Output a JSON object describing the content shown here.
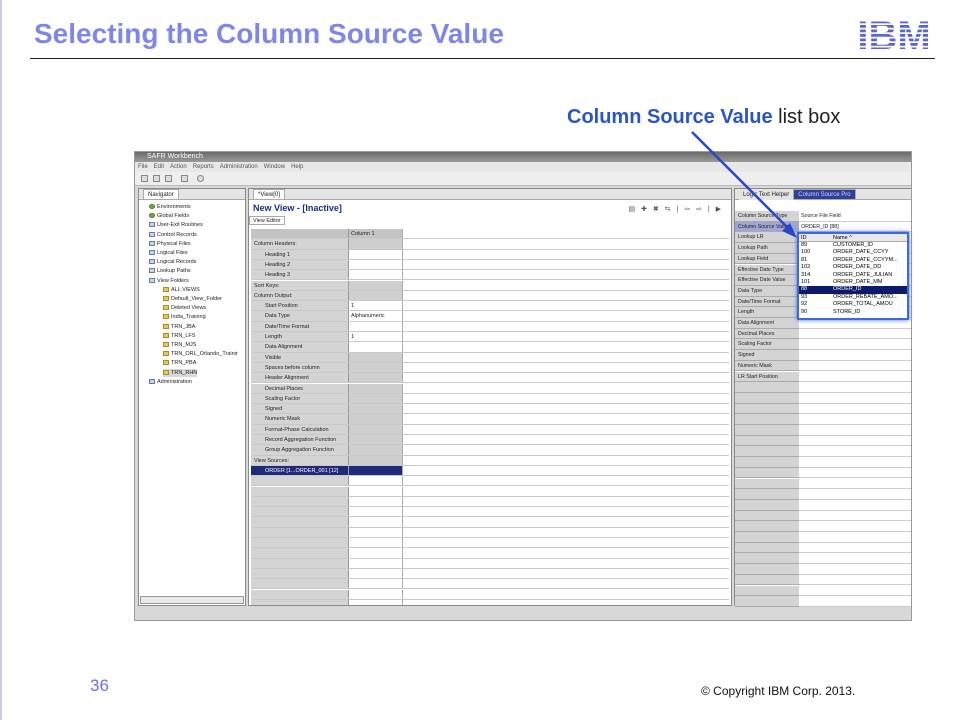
{
  "slide": {
    "title": "Selecting the Column Source Value",
    "callout_bold": "Column Source Value",
    "callout_rest": " list box",
    "page_number": "36",
    "copyright": "© Copyright  IBM Corp. 2013.",
    "logo_text": "IBM"
  },
  "app": {
    "window_title": "SAFR Workbench",
    "menu": [
      "File",
      "Edit",
      "Action",
      "Reports",
      "Administration",
      "Window",
      "Help"
    ]
  },
  "navigator": {
    "tab": "Navigator",
    "items": [
      {
        "label": "Environments",
        "indent": 0
      },
      {
        "label": "Global Fields",
        "indent": 0
      },
      {
        "label": "User-Exit Routines",
        "indent": 0
      },
      {
        "label": "Control Records",
        "indent": 0
      },
      {
        "label": "Physical Files",
        "indent": 0
      },
      {
        "label": "Logical Files",
        "indent": 0
      },
      {
        "label": "Logical Records",
        "indent": 0
      },
      {
        "label": "Lookup Paths",
        "indent": 0
      },
      {
        "label": "View Folders",
        "indent": 0
      },
      {
        "label": "ALL VIEWS",
        "indent": 1
      },
      {
        "label": "Default_View_Folder",
        "indent": 1
      },
      {
        "label": "Deleted Views",
        "indent": 1
      },
      {
        "label": "India_Training",
        "indent": 1
      },
      {
        "label": "TRN_JBA",
        "indent": 1
      },
      {
        "label": "TRN_LFS",
        "indent": 1
      },
      {
        "label": "TRN_MJS",
        "indent": 1
      },
      {
        "label": "TRN_ORL_Orlando_Trainir",
        "indent": 1
      },
      {
        "label": "TRN_PBA",
        "indent": 1
      },
      {
        "label": "TRN_RHN",
        "indent": 1
      },
      {
        "label": "Administration",
        "indent": 0
      }
    ]
  },
  "view_editor": {
    "tab": "*View[0]",
    "title": "New View - [Inactive]",
    "subtab": "View Editor",
    "column_header": "Column 1",
    "rows": [
      {
        "label": "Column Headers:",
        "value": "",
        "hd": true
      },
      {
        "label": "Heading 1",
        "value": ""
      },
      {
        "label": "Heading 2",
        "value": ""
      },
      {
        "label": "Heading 3",
        "value": ""
      },
      {
        "label": "Sort Keys:",
        "value": "",
        "hd": true
      },
      {
        "label": "Column Output:",
        "value": "",
        "hd": true
      },
      {
        "label": "Start Position",
        "value": "1"
      },
      {
        "label": "Data Type",
        "value": "Alphanumeric"
      },
      {
        "label": "Date/Time Format",
        "value": ""
      },
      {
        "label": "Length",
        "value": "1"
      },
      {
        "label": "Data Alignment",
        "value": ""
      },
      {
        "label": "Visible",
        "value": ""
      },
      {
        "label": "Spaces before column",
        "value": ""
      },
      {
        "label": "Header Alignment",
        "value": ""
      },
      {
        "label": "Decimal Places",
        "value": ""
      },
      {
        "label": "Scaling Factor",
        "value": ""
      },
      {
        "label": "Signed",
        "value": ""
      },
      {
        "label": "Numeric Mask",
        "value": ""
      },
      {
        "label": "Format-Phase Calculation",
        "value": ""
      },
      {
        "label": "Record Aggregation Function",
        "value": ""
      },
      {
        "label": "Group Aggregation Function",
        "value": ""
      },
      {
        "label": "View Sources:",
        "value": "",
        "hd": true
      },
      {
        "label": "ORDER [1...ORDER_001 [12]",
        "value": ""
      }
    ]
  },
  "source_panel": {
    "tab1": "Logic Text Helper",
    "tab2": "Column Source Pro",
    "rows": [
      {
        "label": "Column Source Type",
        "value": "Source File Field"
      },
      {
        "label": "Column Source Value",
        "value": "ORDER_ID [88]"
      },
      {
        "label": "Lookup LR",
        "value": ""
      },
      {
        "label": "Lookup Path",
        "value": ""
      },
      {
        "label": "Lookup Field",
        "value": ""
      },
      {
        "label": "Effective Date Type",
        "value": ""
      },
      {
        "label": "Effective Date Value",
        "value": ""
      },
      {
        "label": "Data Type",
        "value": ""
      },
      {
        "label": "Date/Time Format",
        "value": ""
      },
      {
        "label": "Length",
        "value": ""
      },
      {
        "label": "Data Alignment",
        "value": ""
      },
      {
        "label": "Decimal Places",
        "value": ""
      },
      {
        "label": "Scaling Factor",
        "value": ""
      },
      {
        "label": "Signed",
        "value": ""
      },
      {
        "label": "Numeric Mask",
        "value": ""
      },
      {
        "label": "LR Start Position",
        "value": ""
      }
    ]
  },
  "listbox": {
    "col_id": "ID",
    "col_name": "Name  ^",
    "items": [
      {
        "id": "89",
        "name": "CUSTOMER_ID"
      },
      {
        "id": "100",
        "name": "ORDER_DATE_CCYY"
      },
      {
        "id": "81",
        "name": "ORDER_DATE_CCYYM..."
      },
      {
        "id": "102",
        "name": "ORDER_DATE_DD"
      },
      {
        "id": "314",
        "name": "ORDER_DATE_JULIAN"
      },
      {
        "id": "101",
        "name": "ORDER_DATE_MM"
      },
      {
        "id": "88",
        "name": "ORDER_ID",
        "selected": true
      },
      {
        "id": "93",
        "name": "ORDER_REBATE_AMO..."
      },
      {
        "id": "92",
        "name": "ORDER_TOTAL_AMOU"
      },
      {
        "id": "90",
        "name": "STORE_ID"
      }
    ]
  }
}
